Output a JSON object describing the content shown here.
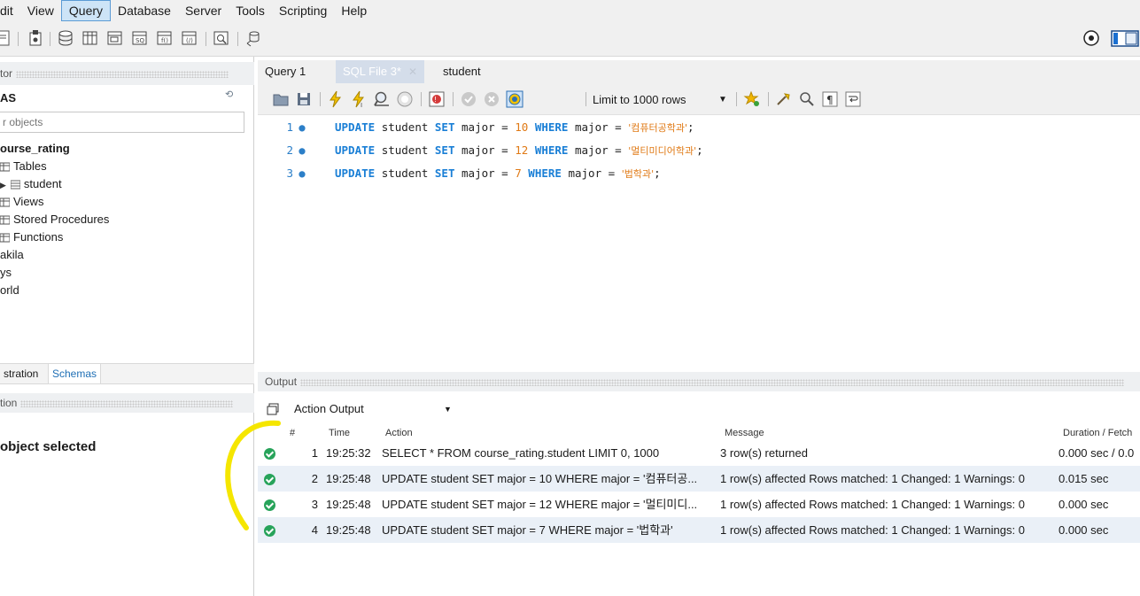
{
  "menu": [
    "dit",
    "View",
    "Query",
    "Database",
    "Server",
    "Tools",
    "Scripting",
    "Help"
  ],
  "menu_active": "Query",
  "sidebar": {
    "navigator_label": "tor",
    "schemas_title": "AS",
    "filter_placeholder": "r objects",
    "tree": [
      {
        "label": "ourse_rating"
      },
      {
        "label": "Tables"
      },
      {
        "label": "student"
      },
      {
        "label": "Views"
      },
      {
        "label": "Stored Procedures"
      },
      {
        "label": "Functions"
      },
      {
        "label": "akila"
      },
      {
        "label": "ys"
      },
      {
        "label": "orld"
      }
    ],
    "tabs": [
      "stration",
      "Schemas"
    ],
    "info_label": "tion",
    "no_object": "object selected"
  },
  "editor": {
    "tabs": [
      "Query 1",
      "SQL File 3*",
      "student"
    ],
    "limit": "Limit to 1000 rows",
    "lines": [
      {
        "n": "1",
        "kw1": "UPDATE",
        "t1": "student",
        "kw2": "SET",
        "t2": "major =",
        "num": "10",
        "kw3": "WHERE",
        "t3": "major =",
        "str": "'컴퓨터공학과'",
        "end": ";"
      },
      {
        "n": "2",
        "kw1": "UPDATE",
        "t1": "student",
        "kw2": "SET",
        "t2": "major =",
        "num": "12",
        "kw3": "WHERE",
        "t3": "major =",
        "str": "'멀티미디어학과'",
        "end": ";"
      },
      {
        "n": "3",
        "kw1": "UPDATE",
        "t1": "student",
        "kw2": "SET",
        "t2": "major =",
        "num": "7",
        "kw3": "WHERE",
        "t3": "major =",
        "str": "'법학과'",
        "end": ";"
      }
    ]
  },
  "output": {
    "title": "Output",
    "selector": "Action Output",
    "columns": [
      "#",
      "Time",
      "Action",
      "Message",
      "Duration / Fetch"
    ],
    "rows": [
      {
        "n": "1",
        "time": "19:25:32",
        "action": "SELECT * FROM course_rating.student LIMIT 0, 1000",
        "message": "3 row(s) returned",
        "duration": "0.000 sec / 0.0"
      },
      {
        "n": "2",
        "time": "19:25:48",
        "action": "UPDATE student SET major = 10 WHERE major = '컴퓨터공...",
        "message": "1 row(s) affected Rows matched: 1  Changed: 1  Warnings: 0",
        "duration": "0.015 sec"
      },
      {
        "n": "3",
        "time": "19:25:48",
        "action": "UPDATE student SET major = 12 WHERE major = '멀티미디...",
        "message": "1 row(s) affected Rows matched: 1  Changed: 1  Warnings: 0",
        "duration": "0.000 sec"
      },
      {
        "n": "4",
        "time": "19:25:48",
        "action": "UPDATE student SET major = 7 WHERE major = '법학과'",
        "message": "1 row(s) affected Rows matched: 1  Changed: 1  Warnings: 0",
        "duration": "0.000 sec"
      }
    ]
  },
  "colors": {
    "accent": "#1a7fd6",
    "number": "#e07a16",
    "ok": "#27a35a",
    "annotation": "#f5e600",
    "tab_selected": "#d4ddea"
  }
}
